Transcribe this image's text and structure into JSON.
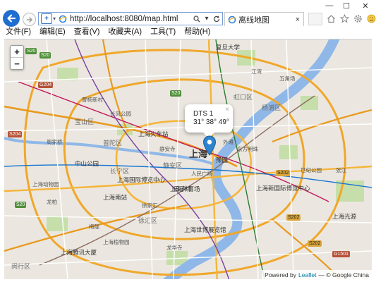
{
  "browser": {
    "url": "http://localhost:8080/map.html",
    "tab_title": "离线地图",
    "tab_close": "×",
    "menu": [
      "文件(F)",
      "编辑(E)",
      "查看(V)",
      "收藏夹(A)",
      "工具(T)",
      "帮助(H)"
    ],
    "win_minimize": "—",
    "win_maximize": "☐",
    "win_close": "✕"
  },
  "map": {
    "zoom_in": "+",
    "zoom_out": "−",
    "popup": {
      "title": "DTS 1",
      "coord": "31° 38° 49°",
      "close": "×"
    },
    "attribution": {
      "prefix": "Powered by",
      "link": "Leaflet",
      "suffix": "— © Google China"
    },
    "city_label": "上海",
    "districts": [
      "宝山区",
      "杨浦区",
      "虹口区",
      "普陀区",
      "静安区",
      "长宁区",
      "徐汇区",
      "闵行区"
    ],
    "pois": [
      "复旦大学",
      "上海南站",
      "上海体育场",
      "上海火车站",
      "中山公园",
      "上海国际博览中心",
      "上海新国际博览中心",
      "上海世博展览馆",
      "上海光源",
      "上海腾讯大厦",
      "上海植物园",
      "田子坊",
      "豫园",
      "外滩",
      "五角场",
      "龙华寺",
      "上海动物园",
      "长风公园",
      "东方明珠",
      "徐家汇",
      "人民广场",
      "静安寺",
      "曹杨新村",
      "江湾",
      "周家桥",
      "龙柏",
      "梅陇",
      "张江",
      "世纪公园"
    ],
    "road_shields": [
      "S20",
      "S20",
      "S20",
      "G204",
      "S204",
      "S202",
      "S202",
      "S202",
      "G1501",
      "S20"
    ],
    "colors": {
      "expressway": "#f5a623",
      "ring": "#e08a1e",
      "river": "#8fb8e8",
      "park": "#c6dfaa"
    }
  }
}
